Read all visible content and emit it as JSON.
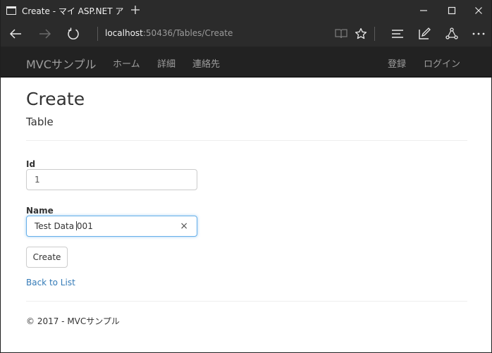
{
  "window": {
    "tab_title": "Create - マイ ASP.NET ア",
    "new_tab_icon": "plus-icon"
  },
  "address_bar": {
    "url_host": "localhost",
    "url_rest": ":50436/Tables/Create"
  },
  "site_nav": {
    "brand": "MVCサンプル",
    "links": [
      "ホーム",
      "詳細",
      "連絡先"
    ],
    "register": "登録",
    "login": "ログイン"
  },
  "page": {
    "title": "Create",
    "subtitle": "Table"
  },
  "form": {
    "id_label": "Id",
    "id_value": "1",
    "name_label": "Name",
    "name_value_before_caret": "Test Data ",
    "name_value_after_caret": "001",
    "clear_glyph": "×",
    "submit_label": "Create"
  },
  "back_link": "Back to List",
  "footer": "© 2017 - MVCサンプル"
}
